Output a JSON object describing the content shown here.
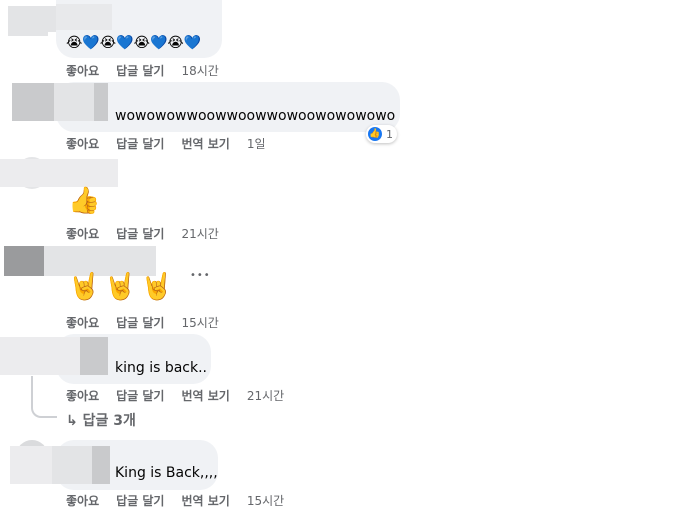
{
  "labels": {
    "like": "좋아요",
    "reply": "답글 달기",
    "translate": "번역 보기"
  },
  "comments": [
    {
      "text": "😭💙😭💙😭💙😭💙",
      "time": "18시간"
    },
    {
      "text": "wowowowwoowwoowwowoowowowowo",
      "time": "1일",
      "reaction_count": "1"
    },
    {
      "text": "👍",
      "time": "21시간"
    },
    {
      "text": "🤘🤘🤘",
      "time": "15시간"
    },
    {
      "text": "king is back..",
      "time": "21시간",
      "replies": "답글 3개"
    },
    {
      "text": "King is Back,,,,",
      "time": "15시간"
    }
  ],
  "icons": {
    "reply_arrow": "↳",
    "more": "•••",
    "like_reaction": "👍"
  },
  "colors": {
    "bubble": "#f0f2f5",
    "meta": "#65676b",
    "like_blue": "#1877f2"
  }
}
